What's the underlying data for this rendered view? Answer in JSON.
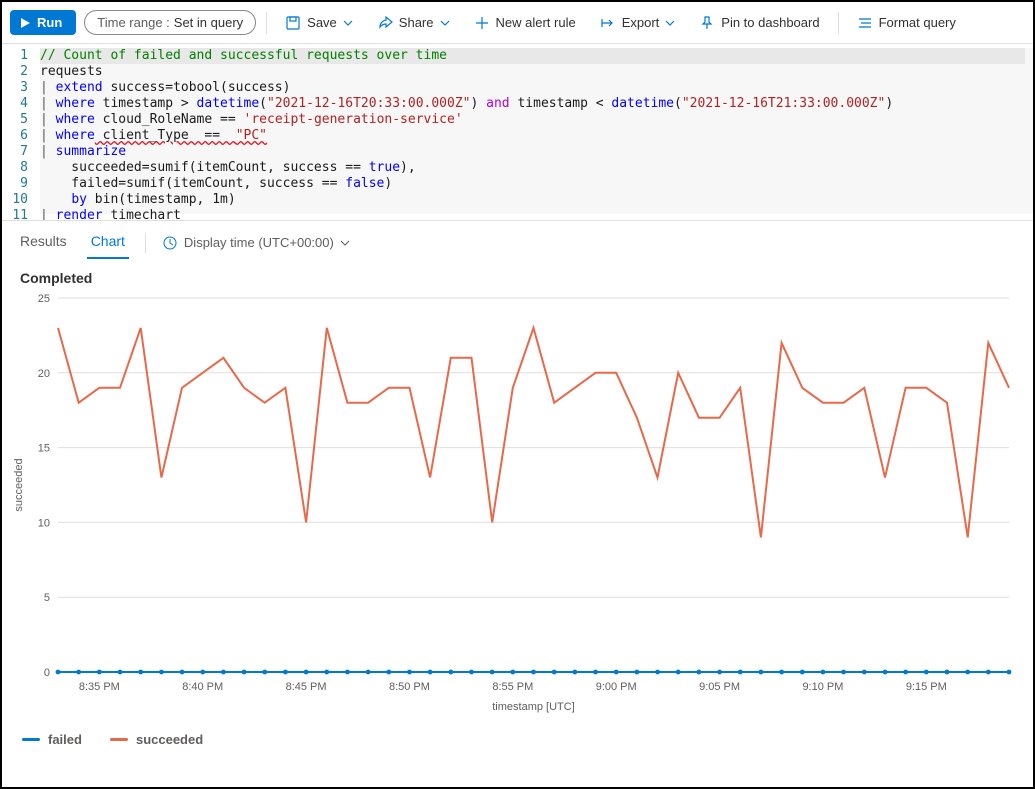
{
  "toolbar": {
    "run_label": "Run",
    "time_range_label": "Time range :",
    "time_range_value": "Set in query",
    "save_label": "Save",
    "share_label": "Share",
    "new_alert_label": "New alert rule",
    "export_label": "Export",
    "pin_label": "Pin to dashboard",
    "format_label": "Format query"
  },
  "editor": {
    "lines": [
      {
        "comment": "// Count of failed and successful requests over time"
      },
      {
        "plain": "requests"
      },
      {
        "pipe": "| ",
        "kw": "extend",
        "rest_plain": " success=tobool(success)"
      },
      {
        "pipe": "| ",
        "kw": "where",
        "rest": " timestamp > ",
        "func1": "datetime",
        "paren1": "(",
        "str1": "\"2021-12-16T20:33:00.000Z\"",
        "paren1b": ") ",
        "op": "and",
        "rest2": " timestamp < ",
        "func2": "datetime",
        "paren2": "(",
        "str2": "\"2021-12-16T21:33:00.000Z\"",
        "paren2b": ")"
      },
      {
        "pipe": "| ",
        "kw": "where",
        "rest_plain": " cloud_RoleName == ",
        "str": "'receipt-generation-service'"
      },
      {
        "pipe": "| ",
        "kw": "where",
        "rest_plain_wave": " client_Type  ==  ",
        "str_wave": "\"PC\""
      },
      {
        "pipe": "| ",
        "kw": "summarize"
      },
      {
        "indent": "    ",
        "plain": "succeeded=sumif(itemCount, success == ",
        "bool": "true",
        "after": "),"
      },
      {
        "indent": "    ",
        "plain": "failed=sumif(itemCount, success == ",
        "bool": "false",
        "after": ")"
      },
      {
        "indent": "    ",
        "kw": "by",
        "rest_plain": " bin(timestamp, 1m)"
      },
      {
        "pipe": "| ",
        "kw": "render",
        "rest_plain": " timechart"
      }
    ]
  },
  "tabs": {
    "results": "Results",
    "chart": "Chart",
    "display_time": "Display time (UTC+00:00)"
  },
  "chart_data": {
    "type": "line",
    "title": "Completed",
    "xlabel": "timestamp [UTC]",
    "ylabel": "succeeded",
    "ylim": [
      0,
      25
    ],
    "yticks": [
      0,
      5,
      10,
      15,
      20,
      25
    ],
    "x_tick_labels": [
      "8:35 PM",
      "8:40 PM",
      "8:45 PM",
      "8:50 PM",
      "8:55 PM",
      "9:00 PM",
      "9:05 PM",
      "9:10 PM",
      "9:15 PM"
    ],
    "x_tick_positions": [
      2,
      7,
      12,
      17,
      22,
      27,
      32,
      37,
      42
    ],
    "n_points": 47,
    "series": [
      {
        "name": "failed",
        "color": "#0078d4",
        "values": [
          0,
          0,
          0,
          0,
          0,
          0,
          0,
          0,
          0,
          0,
          0,
          0,
          0,
          0,
          0,
          0,
          0,
          0,
          0,
          0,
          0,
          0,
          0,
          0,
          0,
          0,
          0,
          0,
          0,
          0,
          0,
          0,
          0,
          0,
          0,
          0,
          0,
          0,
          0,
          0,
          0,
          0,
          0,
          0,
          0,
          0,
          0
        ]
      },
      {
        "name": "succeeded",
        "color": "#e8694a",
        "values": [
          23,
          18,
          19,
          19,
          23,
          13,
          19,
          20,
          21,
          19,
          18,
          19,
          10,
          23,
          18,
          18,
          19,
          19,
          13,
          21,
          21,
          10,
          19,
          23,
          18,
          19,
          20,
          20,
          17,
          13,
          20,
          17,
          17,
          19,
          9,
          22,
          19,
          18,
          18,
          19,
          13,
          19,
          19,
          18,
          9,
          22,
          19
        ]
      }
    ]
  },
  "legend": {
    "failed": "failed",
    "succeeded": "succeeded"
  }
}
